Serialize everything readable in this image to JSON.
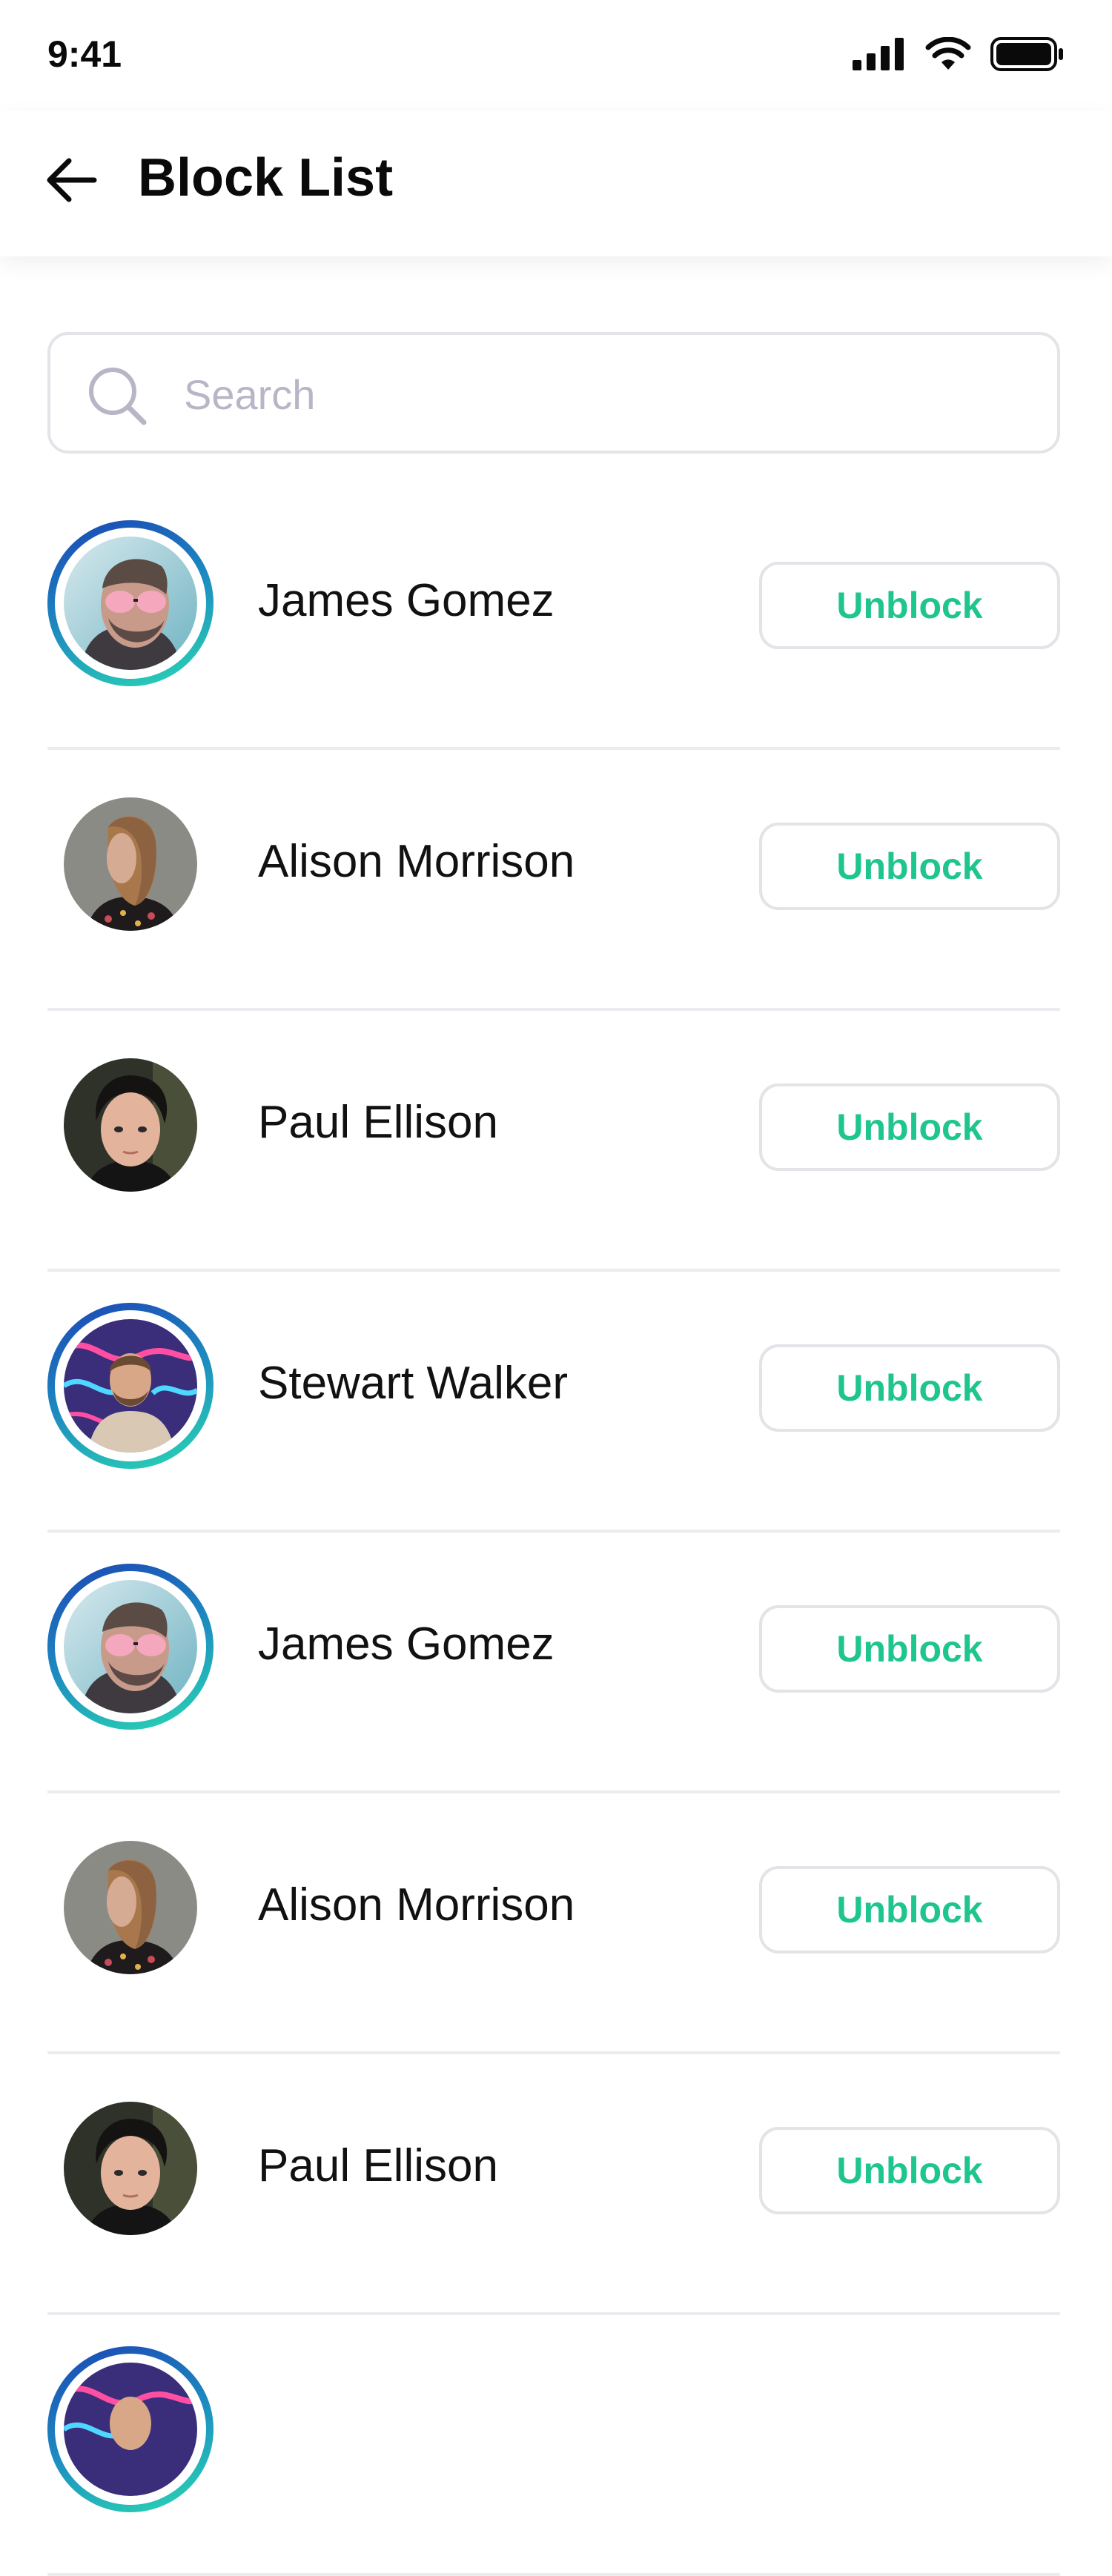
{
  "status_bar": {
    "time": "9:41",
    "icons": [
      "cellular-signal-icon",
      "wifi-icon",
      "battery-icon"
    ]
  },
  "header": {
    "title": "Block List",
    "back_icon": "arrow-left-icon"
  },
  "search": {
    "placeholder": "Search",
    "value": "",
    "icon": "search-icon"
  },
  "colors": {
    "accent": "#1fc58e",
    "ring_start": "#1c44b4",
    "ring_end": "#2bd9b3",
    "border": "#e3e3e8",
    "placeholder": "#b7b6c6"
  },
  "blocked_users": [
    {
      "name": "James Gomez",
      "action": "Unblock",
      "has_story_ring": true
    },
    {
      "name": "Alison Morrison",
      "action": "Unblock",
      "has_story_ring": false
    },
    {
      "name": "Paul Ellison",
      "action": "Unblock",
      "has_story_ring": false
    },
    {
      "name": "Stewart Walker",
      "action": "Unblock",
      "has_story_ring": true
    },
    {
      "name": "James Gomez",
      "action": "Unblock",
      "has_story_ring": true
    },
    {
      "name": "Alison Morrison",
      "action": "Unblock",
      "has_story_ring": false
    },
    {
      "name": "Paul Ellison",
      "action": "Unblock",
      "has_story_ring": false
    },
    {
      "name": "",
      "action": "",
      "has_story_ring": true
    }
  ]
}
